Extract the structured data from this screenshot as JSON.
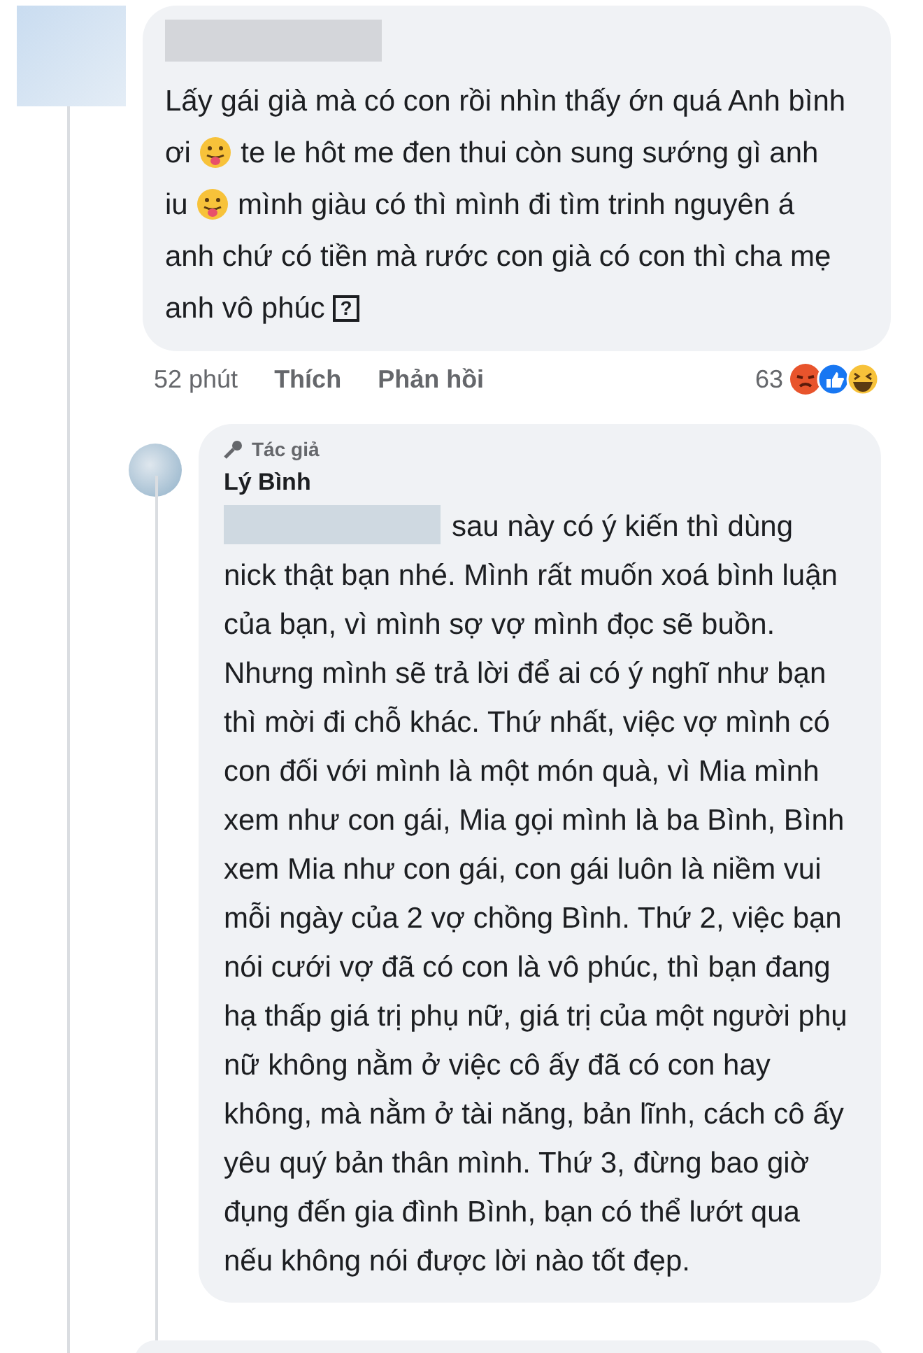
{
  "comment": {
    "parts": [
      {
        "kind": "text",
        "text": "Lấy gái già mà có con rồi nhìn thấy ớn quá Anh bình ơi "
      },
      {
        "kind": "emoji"
      },
      {
        "kind": "text",
        "text": " te le hôt me đen thui còn sung sướng gì anh iu "
      },
      {
        "kind": "emoji"
      },
      {
        "kind": "text",
        "text": " mình giàu có thì mình đi tìm trinh nguyên á anh chứ có tiền mà rước con già có con thì cha mẹ anh vô phúc "
      },
      {
        "kind": "glyph",
        "text": "?"
      }
    ],
    "time": "52 phút",
    "like": "Thích",
    "reply": "Phản hồi",
    "reaction_count": "63"
  },
  "reply": {
    "badge": "Tác giả",
    "author": "Lý Bình",
    "text": "sau này có ý kiến thì dùng nick thật bạn nhé. Mình rất muốn xoá bình luận của bạn, vì mình sợ vợ mình đọc sẽ buồn. Nhưng mình sẽ trả lời để ai có ý nghĩ như bạn thì mời đi chỗ khác. Thứ nhất, việc vợ mình có con đối với mình là một món quà, vì Mia mình xem như con gái, Mia gọi mình là ba Bình, Bình xem Mia như con gái, con gái luôn là niềm vui mỗi ngày của 2 vợ chồng Bình. Thứ 2, việc bạn nói cưới vợ đã có con là vô phúc, thì bạn đang hạ thấp giá trị phụ nữ, giá trị của một người phụ nữ không nằm ở việc cô ấy đã có con hay không, mà nằm ở tài năng, bản lĩnh, cách cô ấy yêu quý bản thân mình. Thứ 3, đừng bao giờ đụng đến gia đình Bình, bạn có thể lướt qua nếu không nói được lời nào tốt đẹp."
  }
}
